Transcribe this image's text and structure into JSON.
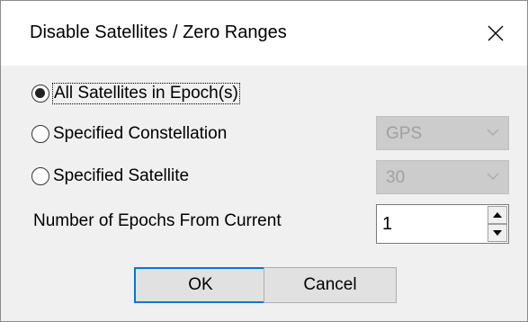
{
  "window": {
    "title": "Disable Satellites / Zero Ranges"
  },
  "options": {
    "all_satellites": {
      "label": "All Satellites in Epoch(s)",
      "checked": true
    },
    "specified_constellation": {
      "label": "Specified Constellation",
      "checked": false
    },
    "specified_satellite": {
      "label": "Specified Satellite",
      "checked": false
    }
  },
  "constellation_combo": {
    "value": "GPS",
    "enabled": false
  },
  "satellite_combo": {
    "value": "30",
    "enabled": false
  },
  "epochs": {
    "label": "Number of Epochs From Current",
    "value": "1"
  },
  "buttons": {
    "ok": "OK",
    "cancel": "Cancel"
  },
  "icons": {
    "close": "close-icon",
    "dropdown": "chevron-down-icon",
    "spin_up": "spin-up-icon",
    "spin_down": "spin-down-icon"
  },
  "colors": {
    "dialog_bg": "#f0f0f0",
    "title_bg": "#ffffff",
    "default_button_border": "#0078d7",
    "disabled_combo_bg": "#cccccc"
  }
}
